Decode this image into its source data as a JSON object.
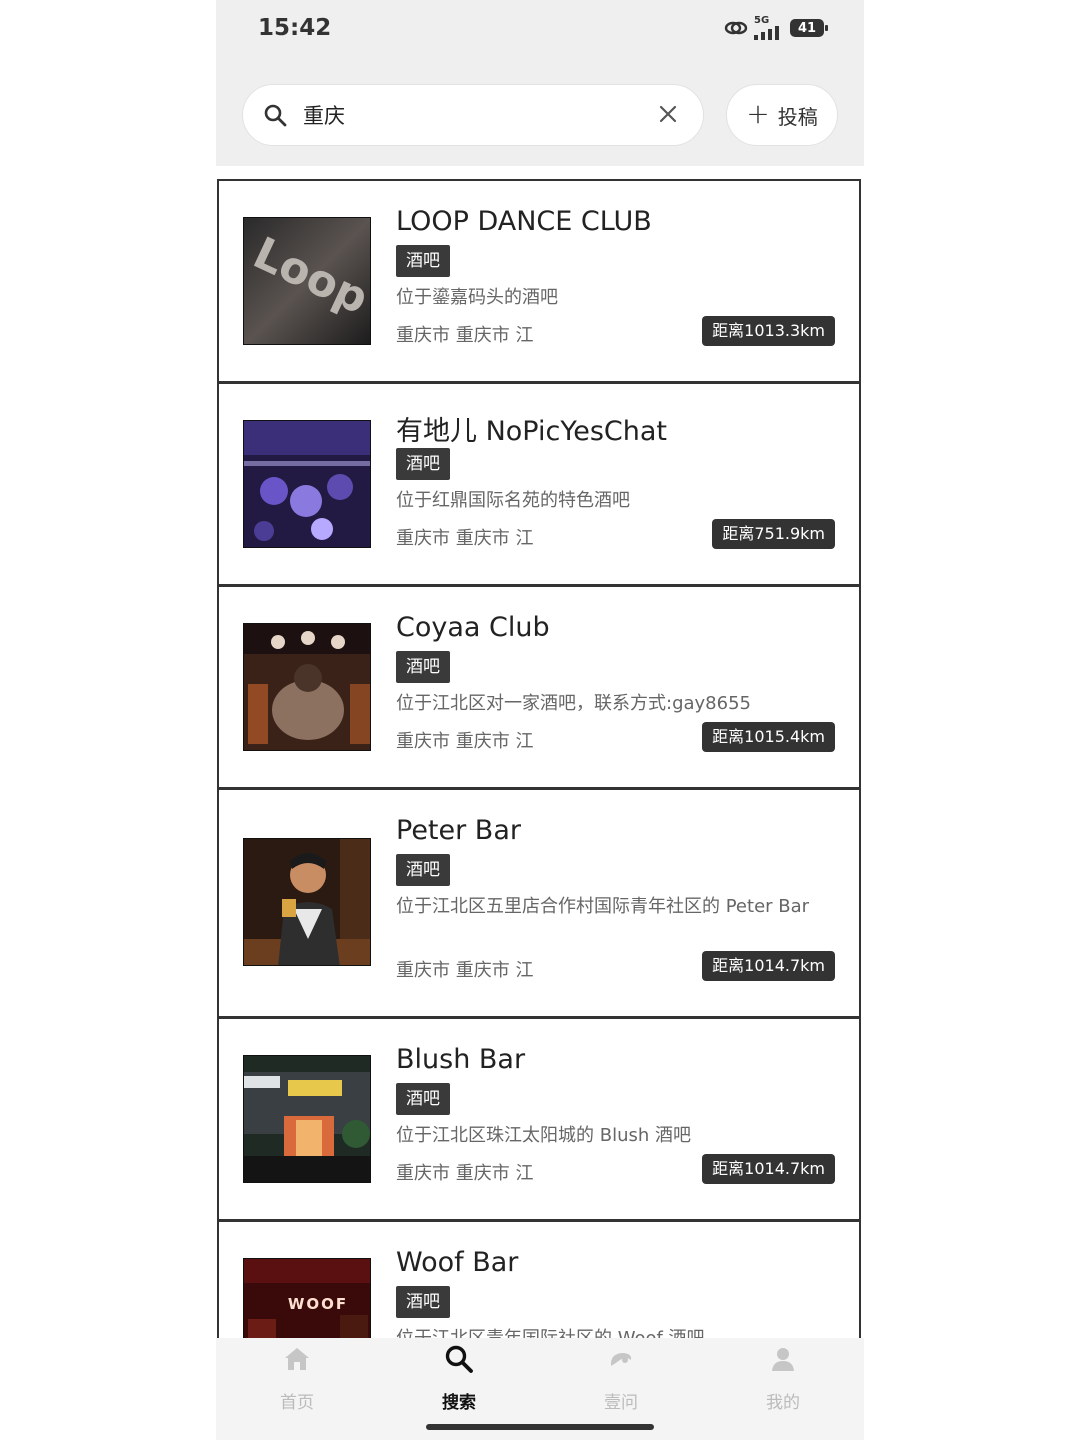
{
  "status_bar": {
    "time": "15:42",
    "network": "5G",
    "battery": "41"
  },
  "search": {
    "value": "重庆",
    "placeholder": ""
  },
  "post_button": {
    "label": "投稿"
  },
  "results": [
    {
      "name": "LOOP DANCE CLUB",
      "tag": "酒吧",
      "description": "位于鎏嘉码头的酒吧",
      "location": "重庆市 重庆市 江",
      "distance": "距离1013.3km",
      "thumb_text": "Loop"
    },
    {
      "name": "有地儿 NoPicYesChat",
      "tag": "酒吧",
      "description": "位于红鼎国际名苑的特色酒吧",
      "location": "重庆市 重庆市 江",
      "distance": "距离751.9km"
    },
    {
      "name": "Coyaa Club",
      "tag": "酒吧",
      "description": "位于江北区对一家酒吧，联系方式:gay8655",
      "location": "重庆市 重庆市 江",
      "distance": "距离1015.4km"
    },
    {
      "name": "Peter Bar",
      "tag": "酒吧",
      "description": "位于江北区五里店合作村国际青年社区的 Peter Bar",
      "location": "重庆市 重庆市 江",
      "distance": "距离1014.7km"
    },
    {
      "name": "Blush Bar",
      "tag": "酒吧",
      "description": "位于江北区珠江太阳城的 Blush 酒吧",
      "location": "重庆市 重庆市 江",
      "distance": "距离1014.7km"
    },
    {
      "name": "Woof Bar",
      "tag": "酒吧",
      "description": "位于江北区青年国际社区的 Woof 酒吧",
      "thumb_text": "WOOF"
    }
  ],
  "tabbar": [
    {
      "label": "首页",
      "icon": "home-icon"
    },
    {
      "label": "搜索",
      "icon": "search-icon",
      "active": true
    },
    {
      "label": "壹问",
      "icon": "chat-icon"
    },
    {
      "label": "我的",
      "icon": "user-icon"
    }
  ],
  "colors": {
    "tag_bg": "#3a3a3a",
    "distance_bg": "#333333",
    "header_bg": "#efefef"
  }
}
